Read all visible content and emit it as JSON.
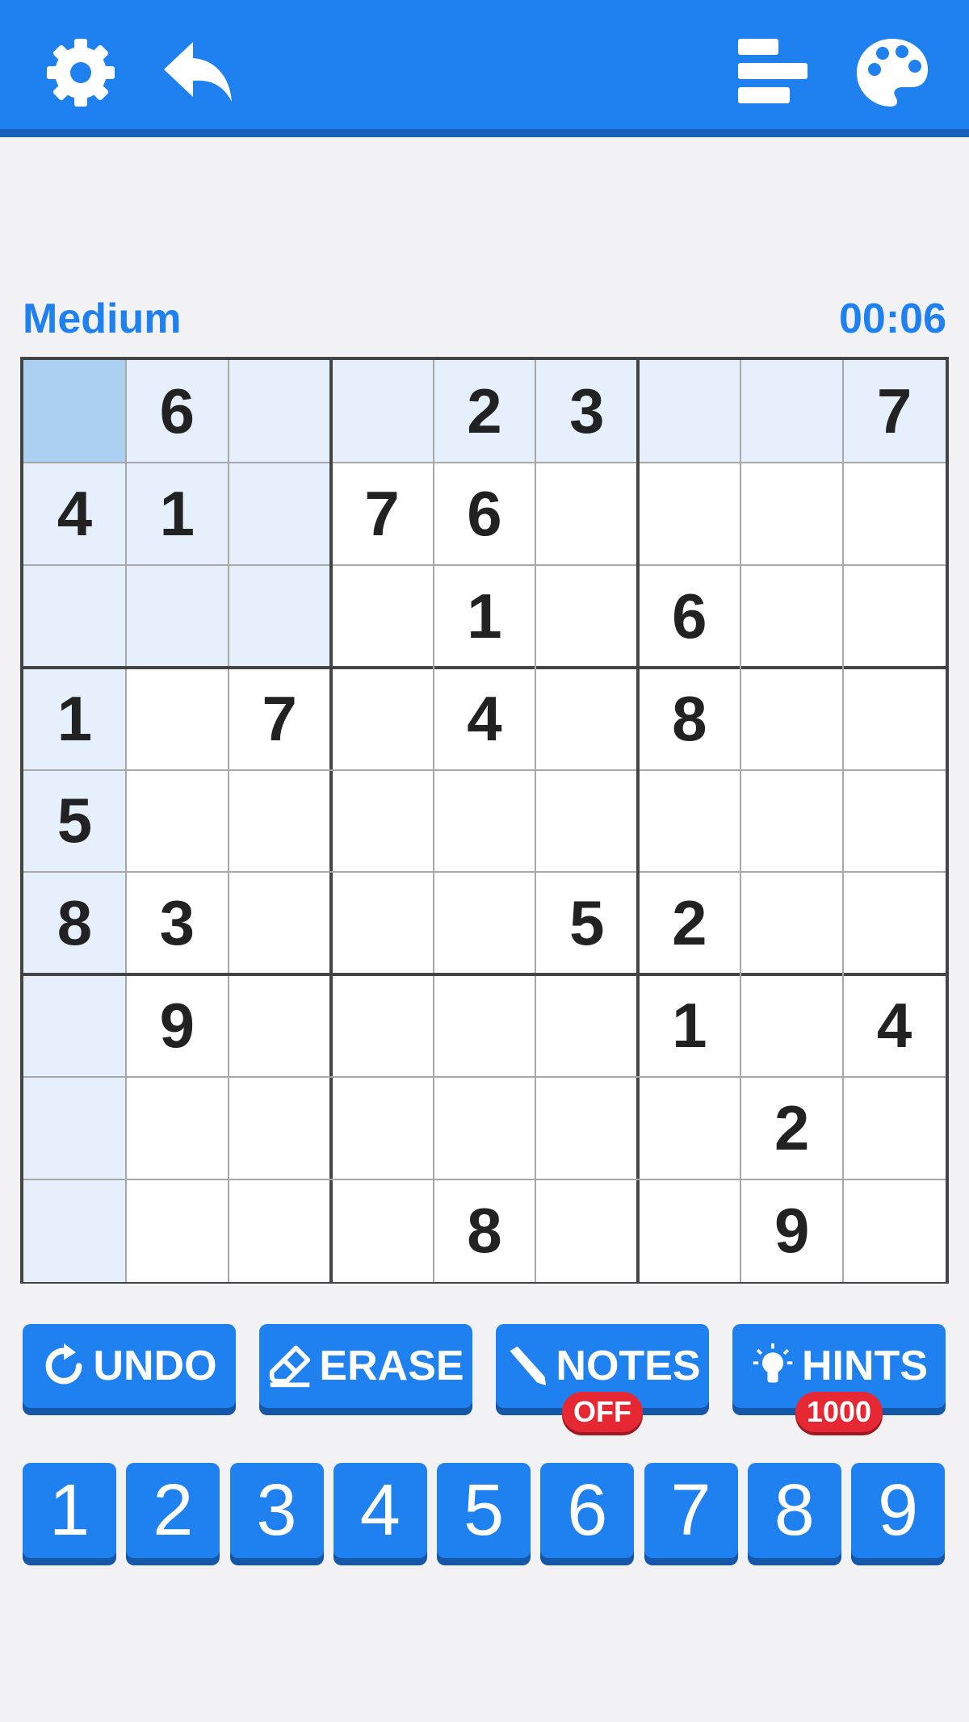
{
  "topbar": {
    "icons": [
      "gear-icon",
      "back-arrow-icon",
      "stats-icon",
      "palette-icon"
    ],
    "color": "#1f80f0"
  },
  "game": {
    "difficulty": "Medium",
    "timer": "00:06"
  },
  "board": {
    "rows": [
      [
        "",
        "6",
        "",
        "",
        "2",
        "3",
        "",
        "",
        "7"
      ],
      [
        "4",
        "1",
        "",
        "7",
        "6",
        "",
        "",
        "",
        ""
      ],
      [
        "",
        "",
        "",
        "",
        "1",
        "",
        "6",
        "",
        ""
      ],
      [
        "1",
        "",
        "7",
        "",
        "4",
        "",
        "8",
        "",
        ""
      ],
      [
        "5",
        "",
        "",
        "",
        "",
        "",
        "",
        "",
        ""
      ],
      [
        "8",
        "3",
        "",
        "",
        "",
        "5",
        "2",
        "",
        ""
      ],
      [
        "",
        "9",
        "",
        "",
        "",
        "",
        "1",
        "",
        "4"
      ],
      [
        "",
        "",
        "",
        "",
        "",
        "",
        "",
        "2",
        ""
      ],
      [
        "",
        "",
        "",
        "",
        "8",
        "",
        "",
        "9",
        ""
      ]
    ],
    "selected": {
      "row": 0,
      "col": 0
    },
    "colors": {
      "selected": "#abd0f2",
      "highlight": "#e6f0fd",
      "empty": "#ffffff",
      "digit": "#222222"
    }
  },
  "actions": {
    "undo": "UNDO",
    "erase": "ERASE",
    "notes": "NOTES",
    "notes_badge": "OFF",
    "hints": "HINTS",
    "hints_badge": "1000"
  },
  "numpad": [
    "1",
    "2",
    "3",
    "4",
    "5",
    "6",
    "7",
    "8",
    "9"
  ]
}
